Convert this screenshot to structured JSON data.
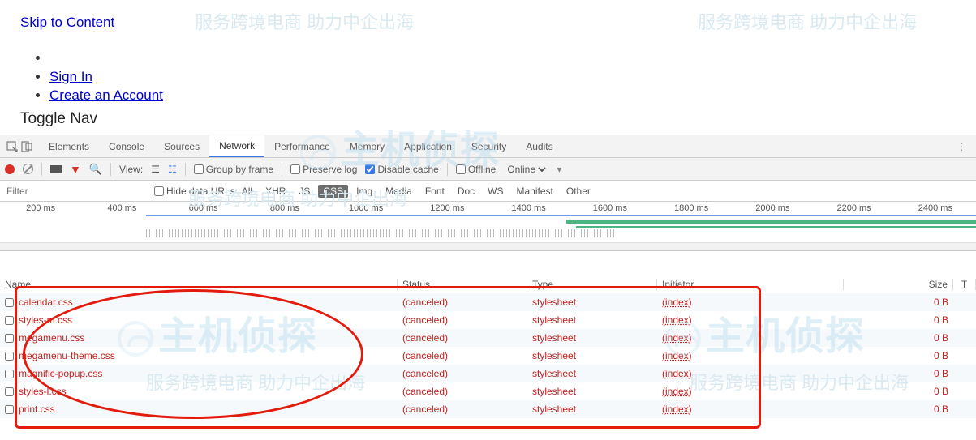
{
  "watermark_text": "服务跨境电商 助力中企出海",
  "logo_text": "主机侦探",
  "page": {
    "skip": "Skip to Content",
    "sign_in": "Sign In",
    "create": "Create an Account",
    "toggle": "Toggle Nav"
  },
  "tabs": {
    "elements": "Elements",
    "console": "Console",
    "sources": "Sources",
    "network": "Network",
    "performance": "Performance",
    "memory": "Memory",
    "application": "Application",
    "security": "Security",
    "audits": "Audits"
  },
  "toolbar": {
    "view": "View:",
    "group": "Group by frame",
    "preserve": "Preserve log",
    "disable": "Disable cache",
    "offline": "Offline",
    "online": "Online"
  },
  "filter": {
    "placeholder": "Filter",
    "hide": "Hide data URLs",
    "all": "All",
    "xhr": "XHR",
    "js": "JS",
    "css": "CSS",
    "img": "Img",
    "media": "Media",
    "font": "Font",
    "doc": "Doc",
    "ws": "WS",
    "manifest": "Manifest",
    "other": "Other"
  },
  "ticks": [
    "200 ms",
    "400 ms",
    "600 ms",
    "800 ms",
    "1000 ms",
    "1200 ms",
    "1400 ms",
    "1600 ms",
    "1800 ms",
    "2000 ms",
    "2200 ms",
    "2400 ms"
  ],
  "cols": {
    "name": "Name",
    "status": "Status",
    "type": "Type",
    "initiator": "Initiator",
    "size": "Size",
    "t": "T"
  },
  "rows": [
    {
      "name": "calendar.css",
      "status": "(canceled)",
      "type": "stylesheet",
      "init": "(index)",
      "size": "0 B"
    },
    {
      "name": "styles-m.css",
      "status": "(canceled)",
      "type": "stylesheet",
      "init": "(index)",
      "size": "0 B"
    },
    {
      "name": "megamenu.css",
      "status": "(canceled)",
      "type": "stylesheet",
      "init": "(index)",
      "size": "0 B"
    },
    {
      "name": "megamenu-theme.css",
      "status": "(canceled)",
      "type": "stylesheet",
      "init": "(index)",
      "size": "0 B"
    },
    {
      "name": "magnific-popup.css",
      "status": "(canceled)",
      "type": "stylesheet",
      "init": "(index)",
      "size": "0 B"
    },
    {
      "name": "styles-l.css",
      "status": "(canceled)",
      "type": "stylesheet",
      "init": "(index)",
      "size": "0 B"
    },
    {
      "name": "print.css",
      "status": "(canceled)",
      "type": "stylesheet",
      "init": "(index)",
      "size": "0 B"
    }
  ]
}
